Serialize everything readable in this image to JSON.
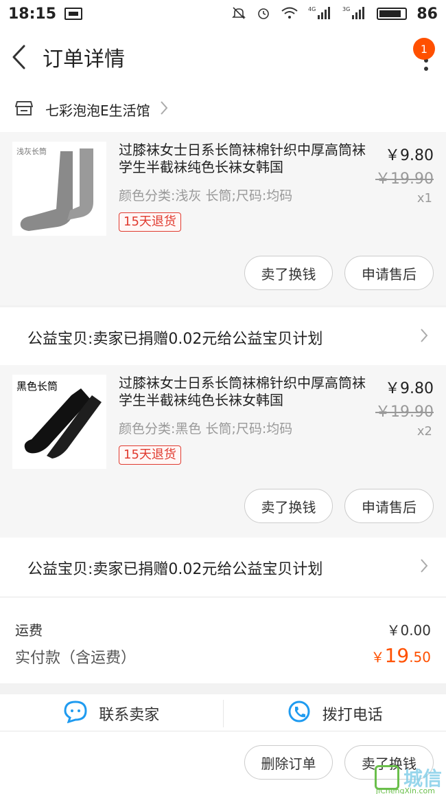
{
  "status_bar": {
    "time": "18:15",
    "battery_level": "86",
    "network_a": "4G",
    "network_b": "3G",
    "icons": [
      "gallery-icon",
      "mute-icon",
      "alarm-icon",
      "wifi-icon",
      "signal-4g-icon",
      "signal-3g-icon",
      "battery-icon"
    ]
  },
  "navbar": {
    "title": "订单详情",
    "badge_count": "1"
  },
  "shop": {
    "name": "七彩泡泡E生活馆"
  },
  "items": [
    {
      "image_label": "浅灰长筒",
      "title": "过膝袜女士日系长筒袜棉针织中厚高筒袜学生半截袜纯色长袜女韩国",
      "sku": "颜色分类:浅灰 长筒;尺码:均码",
      "return_tag": "15天退货",
      "price": "￥9.80",
      "old_price": "￥19.90",
      "qty": "x1",
      "btn_sell": "卖了换钱",
      "btn_after": "申请售后",
      "color": "#8a8a8a"
    },
    {
      "image_label": "黑色长筒",
      "title": "过膝袜女士日系长筒袜棉针织中厚高筒袜学生半截袜纯色长袜女韩国",
      "sku": "颜色分类:黑色 长筒;尺码:均码",
      "return_tag": "15天退货",
      "price": "￥9.80",
      "old_price": "￥19.90",
      "qty": "x2",
      "btn_sell": "卖了换钱",
      "btn_after": "申请售后",
      "color": "#111111"
    }
  ],
  "charity": "公益宝贝:卖家已捐赠0.02元给公益宝贝计划",
  "totals": {
    "shipping_label": "运费",
    "shipping_value": "￥0.00",
    "paid_label": "实付款（含运费）",
    "paid_currency": "￥",
    "paid_int": "19",
    "paid_dec": ".50"
  },
  "contact": {
    "seller": "联系卖家",
    "call": "拨打电话"
  },
  "bottom": {
    "delete": "删除订单",
    "sell": "卖了换钱"
  },
  "watermark": {
    "text": "城信",
    "sub": "JiChengXin.com"
  },
  "colors": {
    "accent": "#ff5000",
    "tag_red": "#e03a2f"
  }
}
